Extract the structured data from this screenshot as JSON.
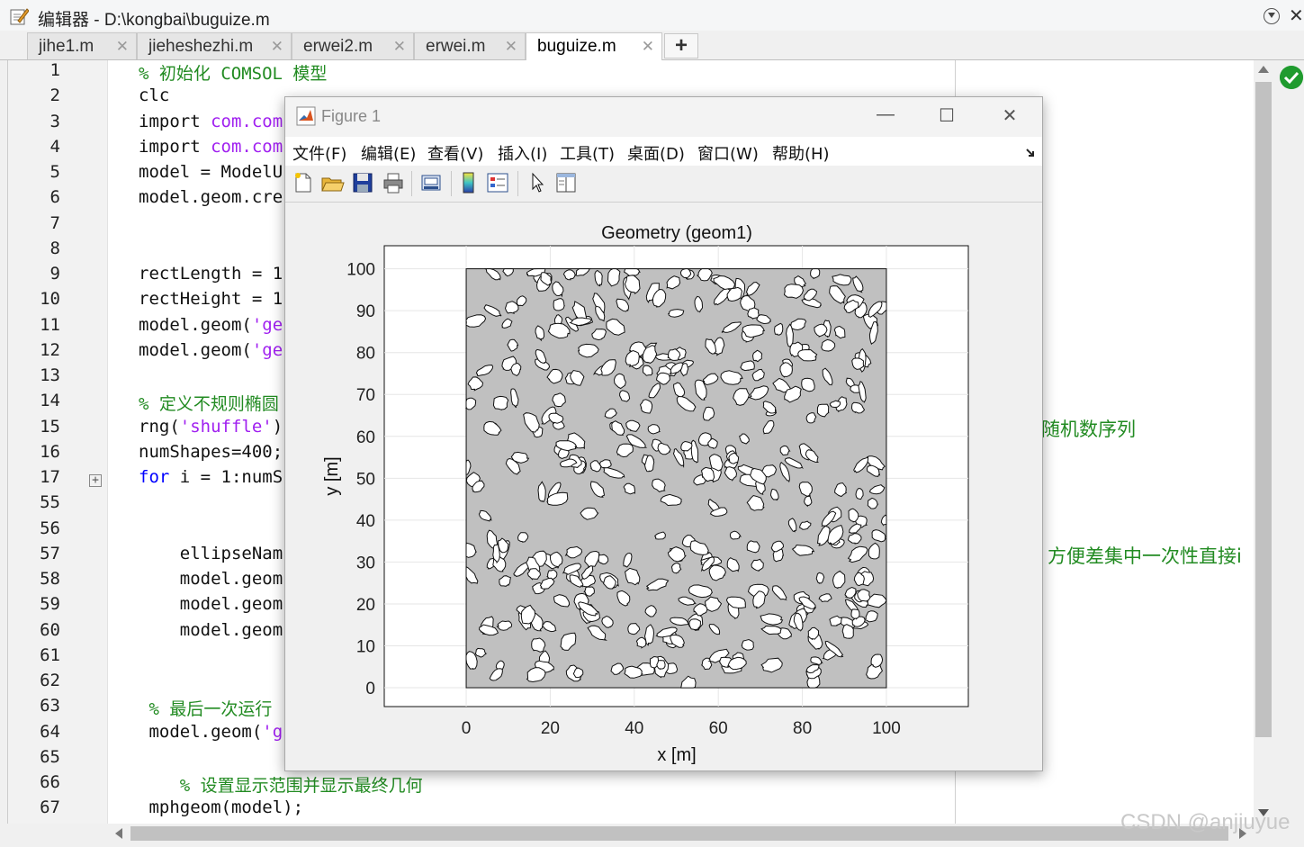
{
  "editor_window": {
    "title": "编辑器 - D:\\kongbai\\buguize.m"
  },
  "tabs": [
    {
      "label": "jihe1.m",
      "active": false
    },
    {
      "label": "jieheshezhi.m",
      "active": false
    },
    {
      "label": "erwei2.m",
      "active": false
    },
    {
      "label": "erwei.m",
      "active": false
    },
    {
      "label": "buguize.m",
      "active": true
    }
  ],
  "tab_add_label": "+",
  "code_lines": [
    {
      "n": "1",
      "indent": 0,
      "parts": [
        {
          "t": "% 初始化 COMSOL 模型",
          "c": "cmt"
        }
      ]
    },
    {
      "n": "2",
      "indent": 0,
      "parts": [
        {
          "t": "clc",
          "c": ""
        }
      ]
    },
    {
      "n": "3",
      "indent": 0,
      "parts": [
        {
          "t": "import ",
          "c": ""
        },
        {
          "t": "com.com",
          "c": "str"
        }
      ]
    },
    {
      "n": "4",
      "indent": 0,
      "parts": [
        {
          "t": "import ",
          "c": ""
        },
        {
          "t": "com.com",
          "c": "str"
        }
      ]
    },
    {
      "n": "5",
      "indent": 0,
      "parts": [
        {
          "t": "model = ModelU",
          "c": ""
        }
      ]
    },
    {
      "n": "6",
      "indent": 0,
      "parts": [
        {
          "t": "model.geom.cre",
          "c": ""
        }
      ]
    },
    {
      "n": "7",
      "indent": 0,
      "parts": []
    },
    {
      "n": "8",
      "indent": 0,
      "parts": []
    },
    {
      "n": "9",
      "indent": 0,
      "parts": [
        {
          "t": "rectLength = 1",
          "c": ""
        }
      ]
    },
    {
      "n": "10",
      "indent": 0,
      "parts": [
        {
          "t": "rectHeight = 1",
          "c": ""
        }
      ]
    },
    {
      "n": "11",
      "indent": 0,
      "parts": [
        {
          "t": "model.geom(",
          "c": ""
        },
        {
          "t": "'ge",
          "c": "str"
        }
      ]
    },
    {
      "n": "12",
      "indent": 0,
      "parts": [
        {
          "t": "model.geom(",
          "c": ""
        },
        {
          "t": "'ge",
          "c": "str"
        }
      ]
    },
    {
      "n": "13",
      "indent": 0,
      "parts": []
    },
    {
      "n": "14",
      "indent": 0,
      "parts": [
        {
          "t": "% 定义不规则椭圆",
          "c": "cmt"
        }
      ]
    },
    {
      "n": "15",
      "indent": 0,
      "parts": [
        {
          "t": "rng(",
          "c": ""
        },
        {
          "t": "'shuffle'",
          "c": "str"
        },
        {
          "t": ")",
          "c": ""
        }
      ]
    },
    {
      "n": "16",
      "indent": 0,
      "parts": [
        {
          "t": "numShapes=400;",
          "c": ""
        }
      ]
    },
    {
      "n": "17",
      "indent": 0,
      "parts": [
        {
          "t": "for",
          "c": "kw"
        },
        {
          "t": " i = 1:numS",
          "c": ""
        }
      ],
      "fold": true
    },
    {
      "n": "55",
      "indent": 0,
      "parts": []
    },
    {
      "n": "56",
      "indent": 0,
      "parts": []
    },
    {
      "n": "57",
      "indent": 4,
      "parts": [
        {
          "t": "ellipseNam",
          "c": ""
        }
      ]
    },
    {
      "n": "58",
      "indent": 4,
      "parts": [
        {
          "t": "model.geom",
          "c": ""
        }
      ]
    },
    {
      "n": "59",
      "indent": 4,
      "parts": [
        {
          "t": "model.geom",
          "c": ""
        }
      ]
    },
    {
      "n": "60",
      "indent": 4,
      "parts": [
        {
          "t": "model.geom",
          "c": ""
        }
      ]
    },
    {
      "n": "61",
      "indent": 0,
      "parts": []
    },
    {
      "n": "62",
      "indent": 0,
      "parts": []
    },
    {
      "n": "63",
      "indent": 1,
      "parts": [
        {
          "t": "% 最后一次运行",
          "c": "cmt"
        }
      ]
    },
    {
      "n": "64",
      "indent": 1,
      "parts": [
        {
          "t": "model.geom(",
          "c": ""
        },
        {
          "t": "'g",
          "c": "str"
        }
      ]
    },
    {
      "n": "65",
      "indent": 0,
      "parts": []
    },
    {
      "n": "66",
      "indent": 4,
      "parts": [
        {
          "t": "% 设置显示范围并显示最终几何",
          "c": "cmt"
        }
      ]
    },
    {
      "n": "67",
      "indent": 1,
      "parts": [
        {
          "t": "mphgeom(model);",
          "c": ""
        }
      ]
    }
  ],
  "right_comments": {
    "line15": "随机数序列",
    "line57": "方便差集中一次性直接i"
  },
  "watermark": "CSDN @anjiuyue",
  "figure": {
    "title": "Figure 1",
    "menu": [
      "文件(F)",
      "编辑(E)",
      "查看(V)",
      "插入(I)",
      "工具(T)",
      "桌面(D)",
      "窗口(W)",
      "帮助(H)"
    ],
    "toolbar_icons": [
      "new-figure-icon",
      "open-icon",
      "save-icon",
      "print-icon",
      "print-preview-icon",
      "colorbar-icon",
      "legend-icon",
      "edit-plot-icon",
      "property-editor-icon"
    ]
  },
  "colors": {
    "comment": "#228b22",
    "string": "#a020f0",
    "keyword": "#0000ff",
    "rect_fill": "#c0c0c0",
    "ellipse_fill": "#ffffff"
  },
  "chart_data": {
    "type": "geometry",
    "title": "Geometry (geom1)",
    "xlabel": "x [m]",
    "ylabel": "y [m]",
    "xlim": [
      -19.5,
      119.5
    ],
    "ylim": [
      -4.5,
      105.5
    ],
    "xticks": [
      0,
      20,
      40,
      60,
      80,
      100
    ],
    "yticks": [
      0,
      10,
      20,
      30,
      40,
      50,
      60,
      70,
      80,
      90,
      100
    ],
    "grid": true,
    "rectangle": {
      "x": 0,
      "y": 0,
      "width": 100,
      "height": 100
    },
    "ellipse_count": 400
  }
}
